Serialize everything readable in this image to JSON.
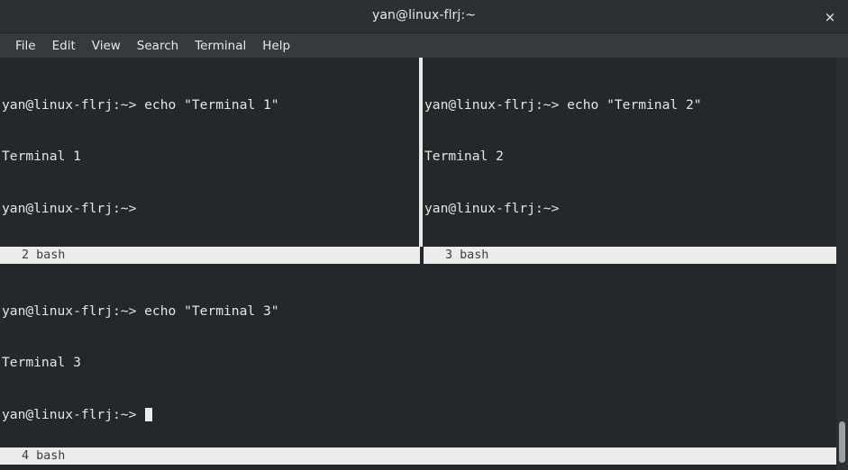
{
  "window": {
    "title": "yan@linux-flrj:~",
    "close_label": "×"
  },
  "menu": {
    "items": [
      {
        "label": "File"
      },
      {
        "label": "Edit"
      },
      {
        "label": "View"
      },
      {
        "label": "Search"
      },
      {
        "label": "Terminal"
      },
      {
        "label": "Help"
      }
    ]
  },
  "panes": [
    {
      "id": "pane-top-left",
      "lines": [
        "yan@linux-flrj:~> echo \"Terminal 1\"",
        "Terminal 1",
        "yan@linux-flrj:~>"
      ],
      "cursor": false,
      "status": "2 bash"
    },
    {
      "id": "pane-top-right",
      "lines": [
        "yan@linux-flrj:~> echo \"Terminal 2\"",
        "Terminal 2",
        "yan@linux-flrj:~>"
      ],
      "cursor": false,
      "status": "3 bash"
    },
    {
      "id": "pane-bottom",
      "lines": [
        "yan@linux-flrj:~> echo \"Terminal 3\"",
        "Terminal 3",
        "yan@linux-flrj:~> "
      ],
      "cursor": true,
      "status": "4 bash"
    }
  ],
  "colors": {
    "titlebar_bg": "#2b3034",
    "menubar_bg": "#343a3d",
    "terminal_bg": "#24282a",
    "terminal_fg": "#e4e6e6",
    "statusbar_bg": "#ececeb",
    "statusbar_fg": "#3a3d3f",
    "divider": "#e9eae7",
    "scrollbar_thumb": "#9ea0a0"
  }
}
